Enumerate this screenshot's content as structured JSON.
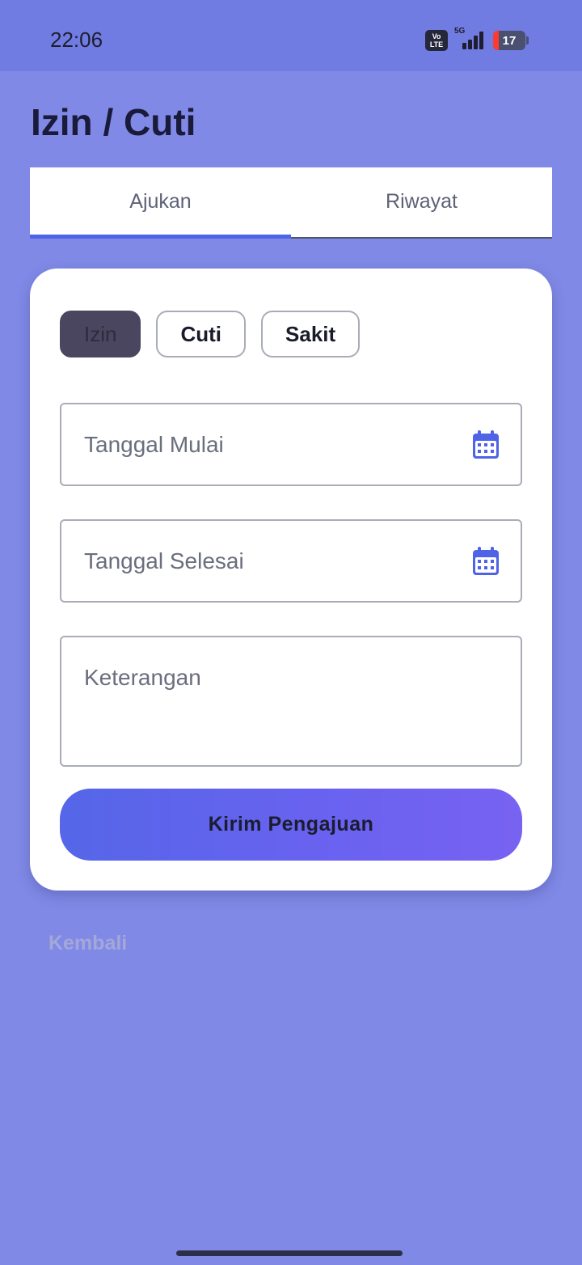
{
  "status_bar": {
    "time": "22:06",
    "volte_label": "Vo\nLTE",
    "network_label": "5G",
    "battery_level": "17"
  },
  "page": {
    "title": "Izin / Cuti"
  },
  "tabs": [
    {
      "label": "Ajukan",
      "active": true
    },
    {
      "label": "Riwayat",
      "active": false
    }
  ],
  "form": {
    "leave_types": [
      {
        "label": "Izin",
        "selected": true
      },
      {
        "label": "Cuti",
        "selected": false
      },
      {
        "label": "Sakit",
        "selected": false
      }
    ],
    "start_date": {
      "placeholder": "Tanggal Mulai",
      "icon": "calendar-icon"
    },
    "end_date": {
      "placeholder": "Tanggal Selesai",
      "icon": "calendar-icon"
    },
    "notes": {
      "placeholder": "Keterangan"
    },
    "submit_label": "Kirim Pengajuan"
  },
  "back_label": "Kembali",
  "colors": {
    "background": "#8089e6",
    "status_bar": "#717ce2",
    "accent": "#4f63e6",
    "button_gradient_start": "#5566e8",
    "button_gradient_end": "#7862f2",
    "selected_chip": "#4a4660"
  }
}
